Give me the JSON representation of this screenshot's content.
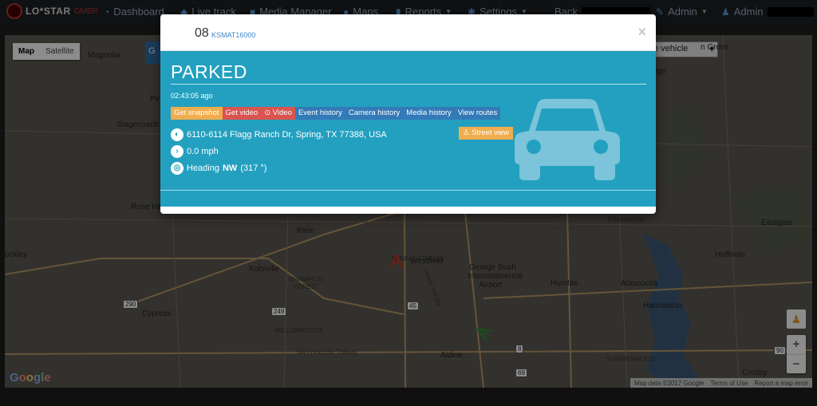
{
  "nav": {
    "brand": "LO*STAR",
    "brand_sub": "GMBR",
    "items": [
      {
        "label": "Dashboard",
        "icon": "dashboard-icon"
      },
      {
        "label": "Live track",
        "icon": "map-marker-icon"
      },
      {
        "label": "Media Manager",
        "icon": "video-camera-icon"
      },
      {
        "label": "Maps",
        "icon": "globe-icon"
      },
      {
        "label": "Reports",
        "icon": "chart-icon"
      },
      {
        "label": "Settings",
        "icon": "gear-icon"
      }
    ],
    "back_label": "Back",
    "admin_label": "Admin",
    "user_label": "Admin"
  },
  "map": {
    "type_buttons": [
      "Map",
      "Satellite"
    ],
    "active_type": "Map",
    "vehicle_select": "e vehicle",
    "labels": {
      "magnolia": "Magnolia",
      "stagecoach": "Stagecoach",
      "rose_hill": "Rose Hill",
      "klein": "Klein",
      "westfield": "Westfield",
      "bush_airport": "George Bush",
      "bush_airport2": "Intercontinental",
      "bush_airport3": "Airport",
      "humble": "Humble",
      "atascocita": "Atascocita",
      "huffman": "Huffman",
      "eastgate": "Eastgate",
      "kohrville": "Kohrville",
      "champion_forest": "CHAMPION",
      "champion_forest2": "FOREST",
      "cypress": "Cypress",
      "willowbrook": "WILLOWBROOK",
      "aldine": "Aldine",
      "harmaston": "Harmaston",
      "kingwood": "KINGWOOD",
      "summerwood": "SUMMERWOOD",
      "crosby": "Crosby",
      "hardy_toll": "Hardy Toll Rd",
      "sh_tollway": "Sam Houston Tollway",
      "rockley": "ockley",
      "in_grove": "n Grove",
      "age": "age",
      "pin": "Pin",
      "spring_station": "SPRING STATION"
    },
    "highways": [
      "290",
      "249",
      "45",
      "8",
      "69",
      "90"
    ],
    "attribution": [
      "Map data ©2017 Google",
      "Terms of Use",
      "Report a map error"
    ],
    "zoom_in": "+",
    "zoom_out": "−",
    "marker_colors": {
      "red": "#c0392b",
      "green": "#2e8b3a"
    }
  },
  "modal": {
    "vehicle_number": "08",
    "vehicle_id": "KSMAT16000",
    "close": "×",
    "status": "PARKED",
    "ago": "02:43:05 ago",
    "buttons": {
      "snapshot": "Get snapshot",
      "video": "Get video",
      "video2": "Video",
      "event_history": "Event history",
      "camera_history": "Camera history",
      "media_history": "Media history",
      "view_routes": "View routes"
    },
    "street_view": "Street view",
    "address": "6110-6114 Flagg Ranch Dr, Spring, TX 77388, USA",
    "speed": "0.0 mph",
    "heading_prefix": "Heading",
    "heading_dir": "NW",
    "heading_deg": "(317 °)",
    "accent": "#23a0c0"
  }
}
